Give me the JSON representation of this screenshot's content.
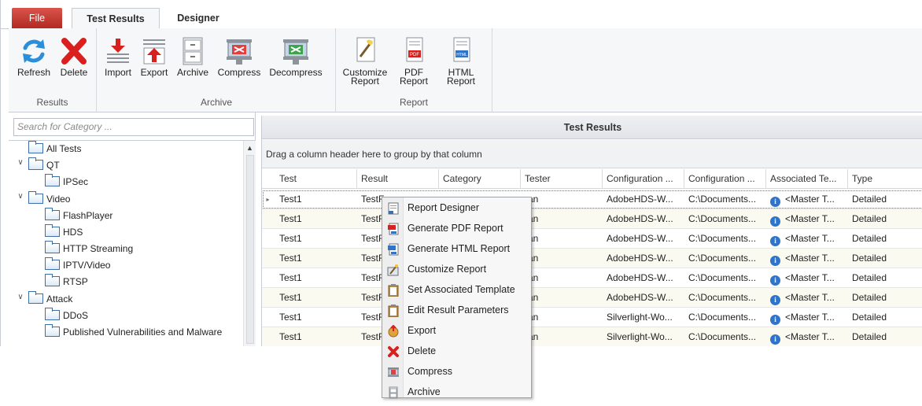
{
  "tabs": {
    "file": "File",
    "test_results": "Test Results",
    "designer": "Designer"
  },
  "ribbon": {
    "groups": {
      "results": "Results",
      "archive": "Archive",
      "report": "Report"
    },
    "buttons": {
      "refresh": "Refresh",
      "delete": "Delete",
      "import": "Import",
      "export": "Export",
      "archive": "Archive",
      "compress": "Compress",
      "decompress": "Decompress",
      "customize_report": "Customize\nReport",
      "pdf_report": "PDF\nReport",
      "html_report": "HTML\nReport"
    }
  },
  "search": {
    "placeholder": "Search for Category ..."
  },
  "tree": [
    {
      "label": "All Tests"
    },
    {
      "label": "QT"
    },
    {
      "label": "IPSec"
    },
    {
      "label": "Video"
    },
    {
      "label": "FlashPlayer"
    },
    {
      "label": "HDS"
    },
    {
      "label": "HTTP Streaming"
    },
    {
      "label": "IPTV/Video"
    },
    {
      "label": "RTSP"
    },
    {
      "label": "Attack"
    },
    {
      "label": "DDoS"
    },
    {
      "label": "Published Vulnerabilities and Malware"
    }
  ],
  "grid": {
    "title": "Test Results",
    "group_hint": "Drag a column header here to group by that column",
    "columns": [
      "Test",
      "Result",
      "Category",
      "Tester",
      "Configuration ...",
      "Configuration ...",
      "Associated Te...",
      "Type"
    ],
    "rows": [
      {
        "test": "Test1",
        "result": "TestF",
        "tester": "ran",
        "config1": "AdobeHDS-W...",
        "config2": "C:\\Documents...",
        "assoc": "<Master T...",
        "type": "Detailed"
      },
      {
        "test": "Test1",
        "result": "TestF",
        "tester": "ran",
        "config1": "AdobeHDS-W...",
        "config2": "C:\\Documents...",
        "assoc": "<Master T...",
        "type": "Detailed"
      },
      {
        "test": "Test1",
        "result": "TestF",
        "tester": "ran",
        "config1": "AdobeHDS-W...",
        "config2": "C:\\Documents...",
        "assoc": "<Master T...",
        "type": "Detailed"
      },
      {
        "test": "Test1",
        "result": "TestF",
        "tester": "ran",
        "config1": "AdobeHDS-W...",
        "config2": "C:\\Documents...",
        "assoc": "<Master T...",
        "type": "Detailed"
      },
      {
        "test": "Test1",
        "result": "TestF",
        "tester": "ran",
        "config1": "AdobeHDS-W...",
        "config2": "C:\\Documents...",
        "assoc": "<Master T...",
        "type": "Detailed"
      },
      {
        "test": "Test1",
        "result": "TestF",
        "tester": "ran",
        "config1": "AdobeHDS-W...",
        "config2": "C:\\Documents...",
        "assoc": "<Master T...",
        "type": "Detailed"
      },
      {
        "test": "Test1",
        "result": "TestF",
        "tester": "ran",
        "config1": "Silverlight-Wo...",
        "config2": "C:\\Documents...",
        "assoc": "<Master T...",
        "type": "Detailed"
      },
      {
        "test": "Test1",
        "result": "TestF",
        "tester": "ran",
        "config1": "Silverlight-Wo...",
        "config2": "C:\\Documents...",
        "assoc": "<Master T...",
        "type": "Detailed"
      }
    ]
  },
  "context_menu": [
    {
      "label": "Report Designer",
      "icon": "report-designer-icon"
    },
    {
      "label": "Generate PDF Report",
      "icon": "pdf-icon"
    },
    {
      "label": "Generate HTML Report",
      "icon": "html-icon"
    },
    {
      "label": "Customize Report",
      "icon": "customize-icon"
    },
    {
      "label": "Set Associated Template",
      "icon": "clipboard-icon"
    },
    {
      "label": "Edit Result Parameters",
      "icon": "clipboard-icon"
    },
    {
      "label": "Export",
      "icon": "export-icon"
    },
    {
      "label": "Delete",
      "icon": "delete-icon"
    },
    {
      "label": "Compress",
      "icon": "compress-icon"
    },
    {
      "label": "Archive",
      "icon": "archive-icon"
    }
  ],
  "colors": {
    "file_tab": "#c0362c",
    "accent_blue": "#2f74c8",
    "delete_red": "#d9201e",
    "row_alt": "#fbfaf0"
  }
}
